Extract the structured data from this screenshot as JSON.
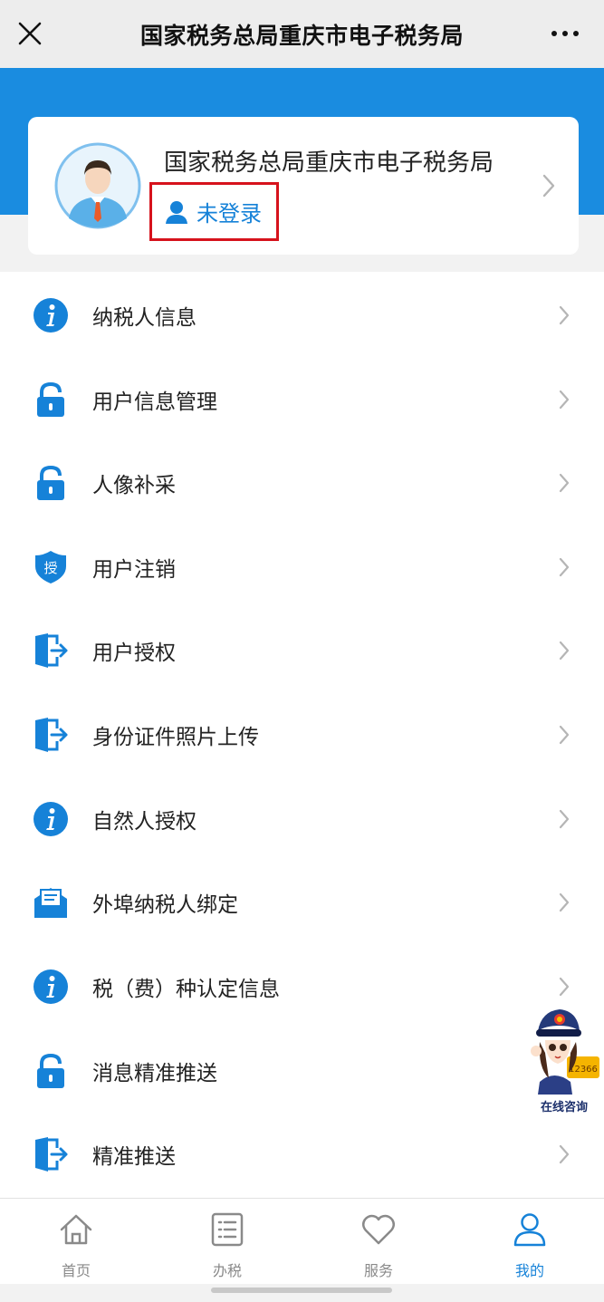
{
  "header": {
    "title": "国家税务总局重庆市电子税务局"
  },
  "profile": {
    "title": "国家税务总局重庆市电子税务局",
    "login_status": "未登录"
  },
  "menu": [
    {
      "label": "纳税人信息",
      "icon": "info-icon"
    },
    {
      "label": "用户信息管理",
      "icon": "lock-icon"
    },
    {
      "label": "人像补采",
      "icon": "lock-icon"
    },
    {
      "label": "用户注销",
      "icon": "shield-icon",
      "icon_text": "授"
    },
    {
      "label": "用户授权",
      "icon": "door-exit-icon"
    },
    {
      "label": "身份证件照片上传",
      "icon": "door-exit-icon"
    },
    {
      "label": "自然人授权",
      "icon": "info-icon"
    },
    {
      "label": "外埠纳税人绑定",
      "icon": "mail-icon"
    },
    {
      "label": "税（费）种认定信息",
      "icon": "info-icon"
    },
    {
      "label": "消息精准推送",
      "icon": "lock-icon"
    },
    {
      "label": "精准推送",
      "icon": "door-exit-icon"
    }
  ],
  "mascot": {
    "label": "在线咨询",
    "phone": "12366"
  },
  "tabs": [
    {
      "label": "首页",
      "icon": "home-icon"
    },
    {
      "label": "办税",
      "icon": "list-icon"
    },
    {
      "label": "服务",
      "icon": "heart-icon"
    },
    {
      "label": "我的",
      "icon": "user-icon",
      "active": true
    }
  ],
  "colors": {
    "primary": "#1682d8",
    "banner": "#1a8ce0",
    "highlight_border": "#d6121c"
  }
}
